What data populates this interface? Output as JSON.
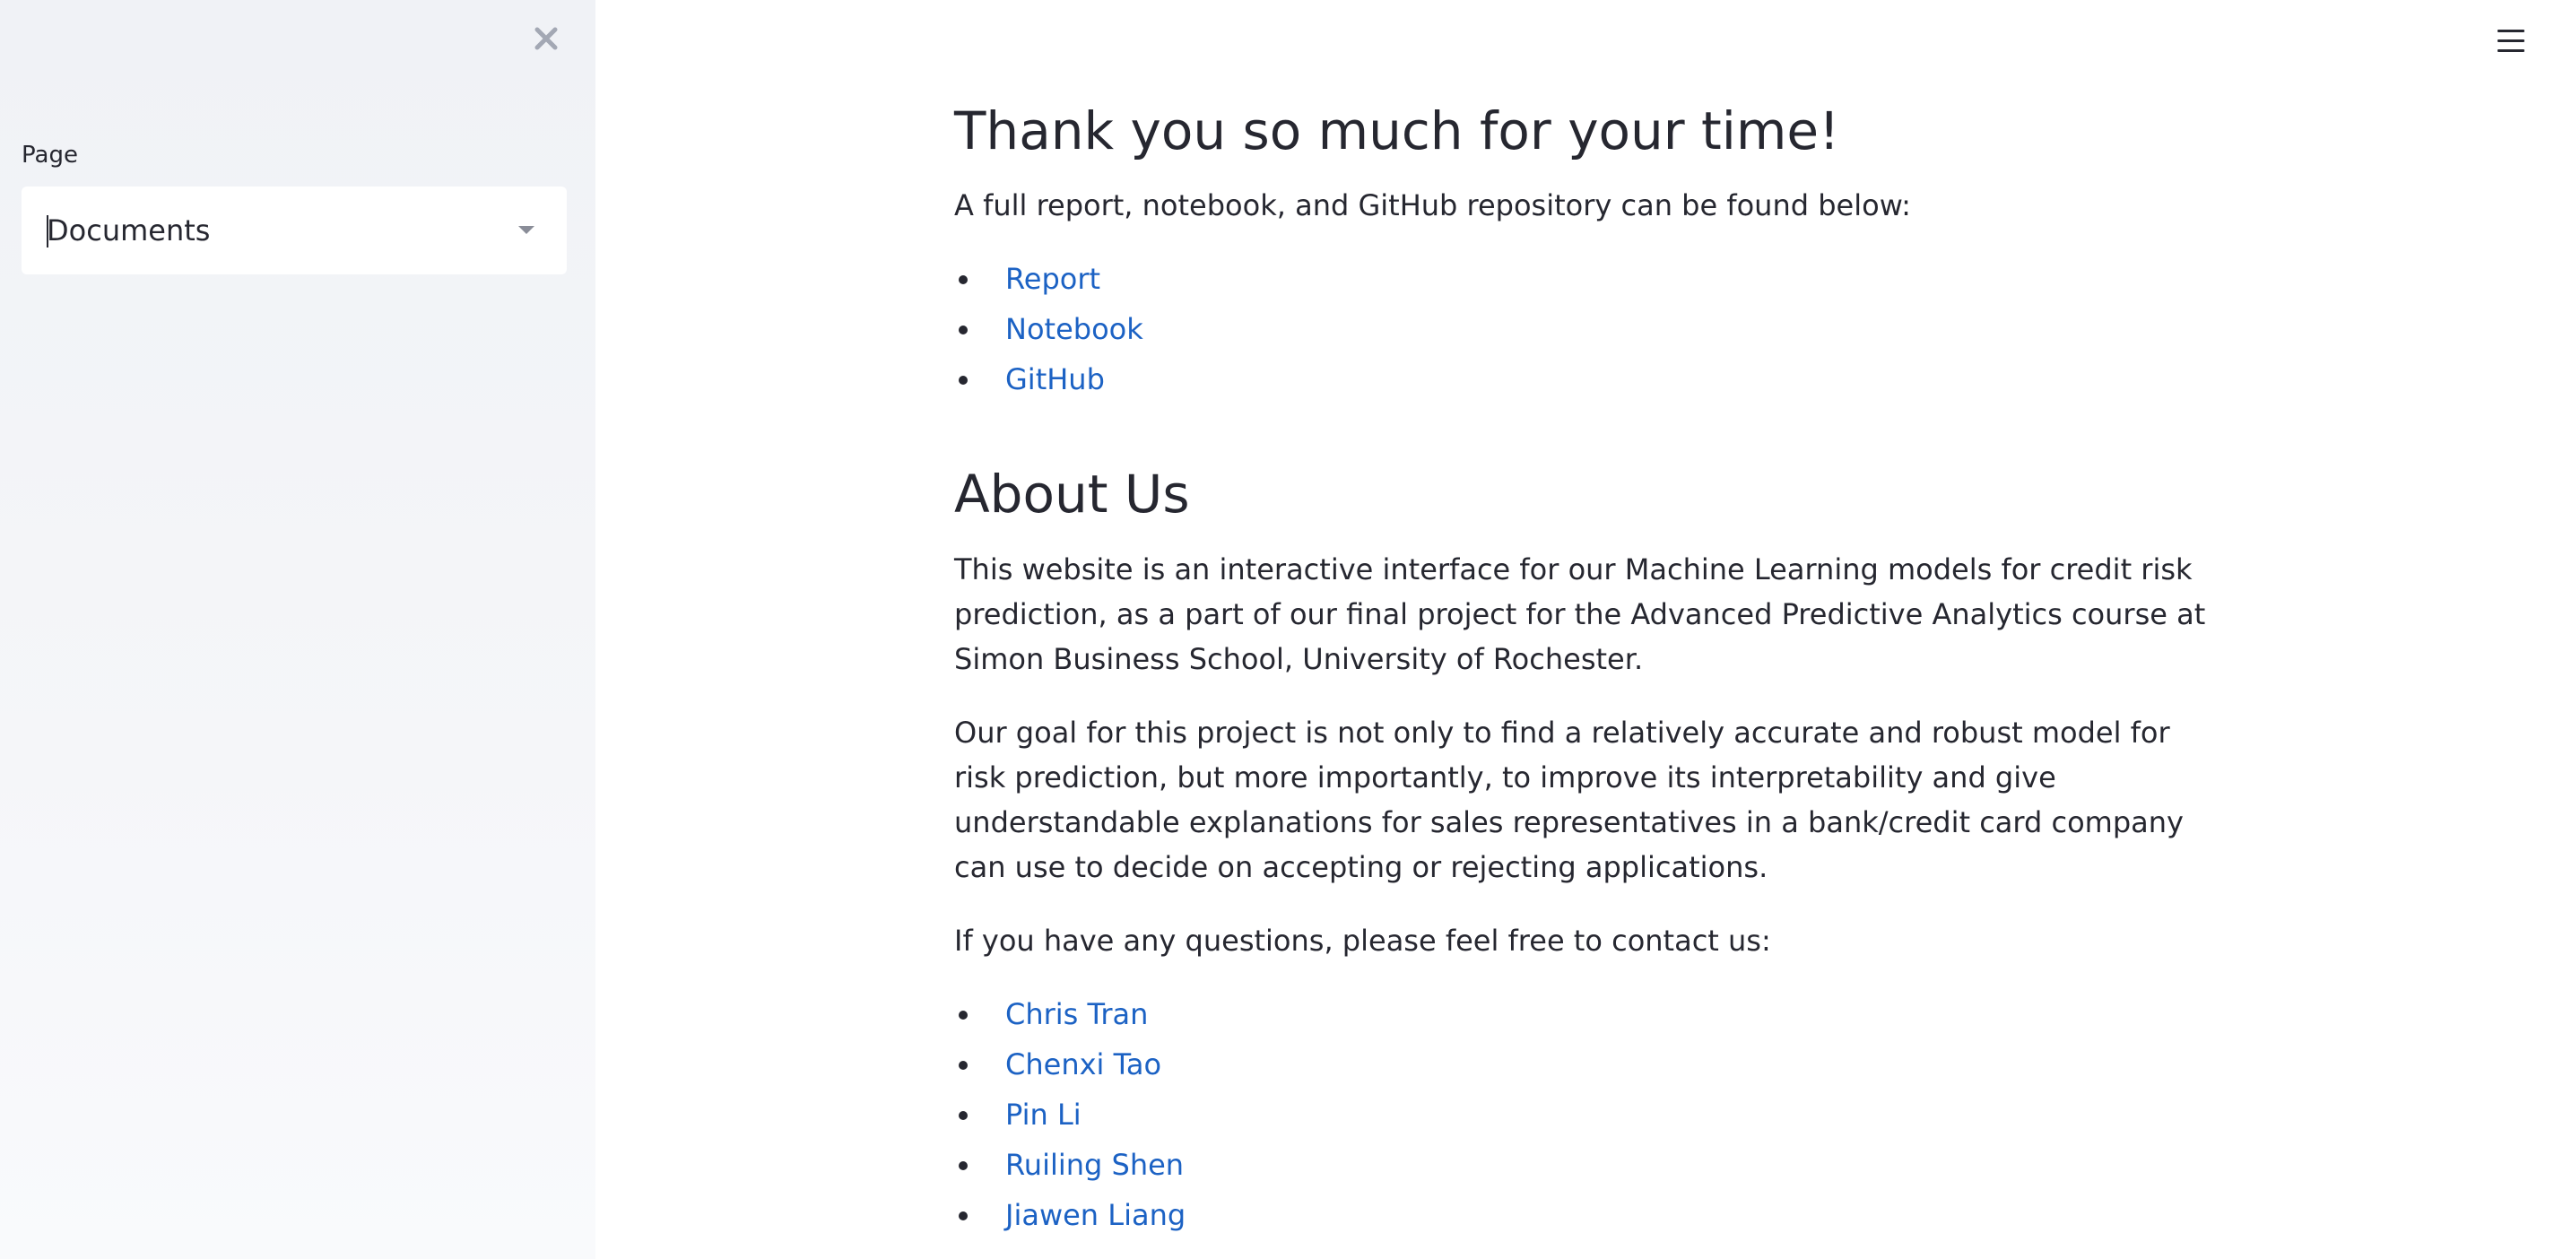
{
  "sidebar": {
    "select_label": "Page",
    "selected_value": "Documents"
  },
  "main": {
    "title": "Thank you so much for your time!",
    "intro": "A full report, notebook, and GitHub repository can be found below:",
    "resource_links": [
      "Report",
      "Notebook",
      "GitHub"
    ],
    "about_heading": "About Us",
    "about_paragraph_1": "This website is an interactive interface for our Machine Learning models for credit risk prediction, as a part of our final project for the Advanced Predictive Analytics course at Simon Business School, University of Rochester.",
    "about_paragraph_2": "Our goal for this project is not only to find a relatively accurate and robust model for risk prediction, but more importantly, to improve its interpretability and give understandable explanations for sales representatives in a bank/credit card company can use to decide on accepting or rejecting applications.",
    "contact_text": "If you have any questions, please feel free to contact us:",
    "contacts": [
      "Chris Tran",
      "Chenxi Tao",
      "Pin Li",
      "Ruiling Shen",
      "Jiawen Liang"
    ]
  },
  "colors": {
    "link": "#1c62c4",
    "text": "#262730",
    "sidebar_bg": "#f0f2f6"
  },
  "icons": {
    "close": "close-icon",
    "menu": "hamburger-menu-icon",
    "dropdown": "chevron-down-icon"
  }
}
